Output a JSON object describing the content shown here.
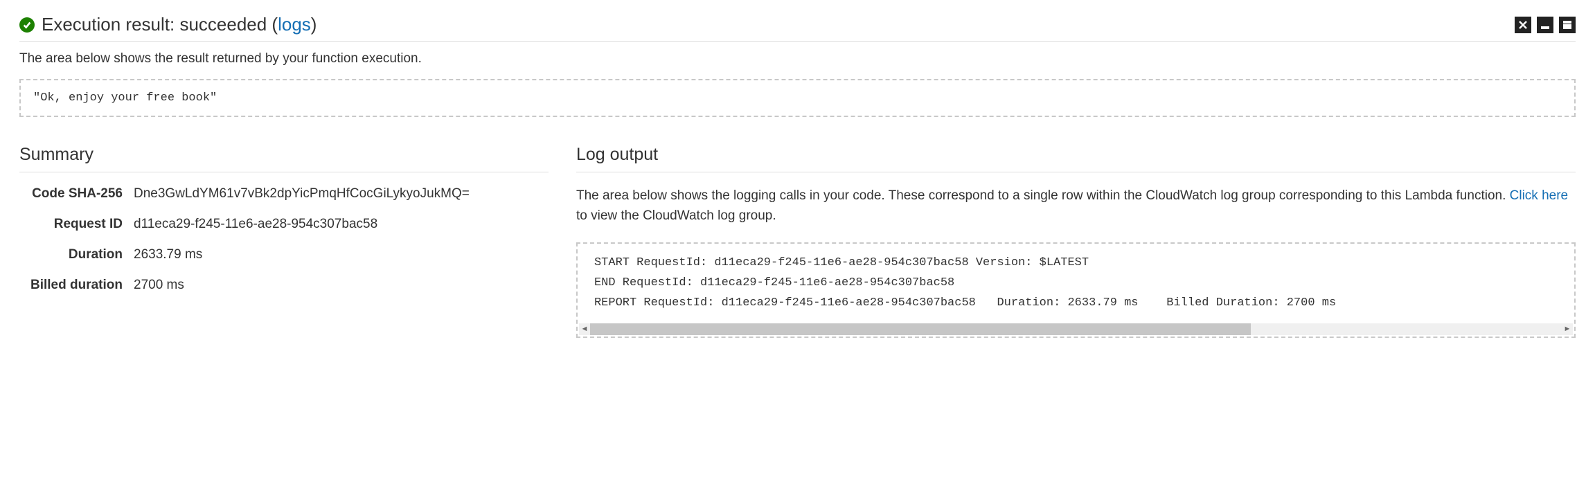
{
  "header": {
    "title_prefix": "Execution result: ",
    "status": "succeeded",
    "logs_label": "logs"
  },
  "description": "The area below shows the result returned by your function execution.",
  "result_output": "\"Ok, enjoy your free book\"",
  "summary": {
    "title": "Summary",
    "rows": [
      {
        "label": "Code SHA-256",
        "value": "Dne3GwLdYM61v7vBk2dpYicPmqHfCocGiLykyoJukMQ="
      },
      {
        "label": "Request ID",
        "value": "d11eca29-f245-11e6-ae28-954c307bac58"
      },
      {
        "label": "Duration",
        "value": "2633.79 ms"
      },
      {
        "label": "Billed duration",
        "value": "2700 ms"
      }
    ]
  },
  "log": {
    "title": "Log output",
    "desc_pre": "The area below shows the logging calls in your code. These correspond to a single row within the CloudWatch log group corresponding to this Lambda function. ",
    "link_text": "Click here",
    "desc_post": " to view the CloudWatch log group.",
    "content": "START RequestId: d11eca29-f245-11e6-ae28-954c307bac58 Version: $LATEST\nEND RequestId: d11eca29-f245-11e6-ae28-954c307bac58\nREPORT RequestId: d11eca29-f245-11e6-ae28-954c307bac58   Duration: 2633.79 ms    Billed Duration: 2700 ms"
  }
}
